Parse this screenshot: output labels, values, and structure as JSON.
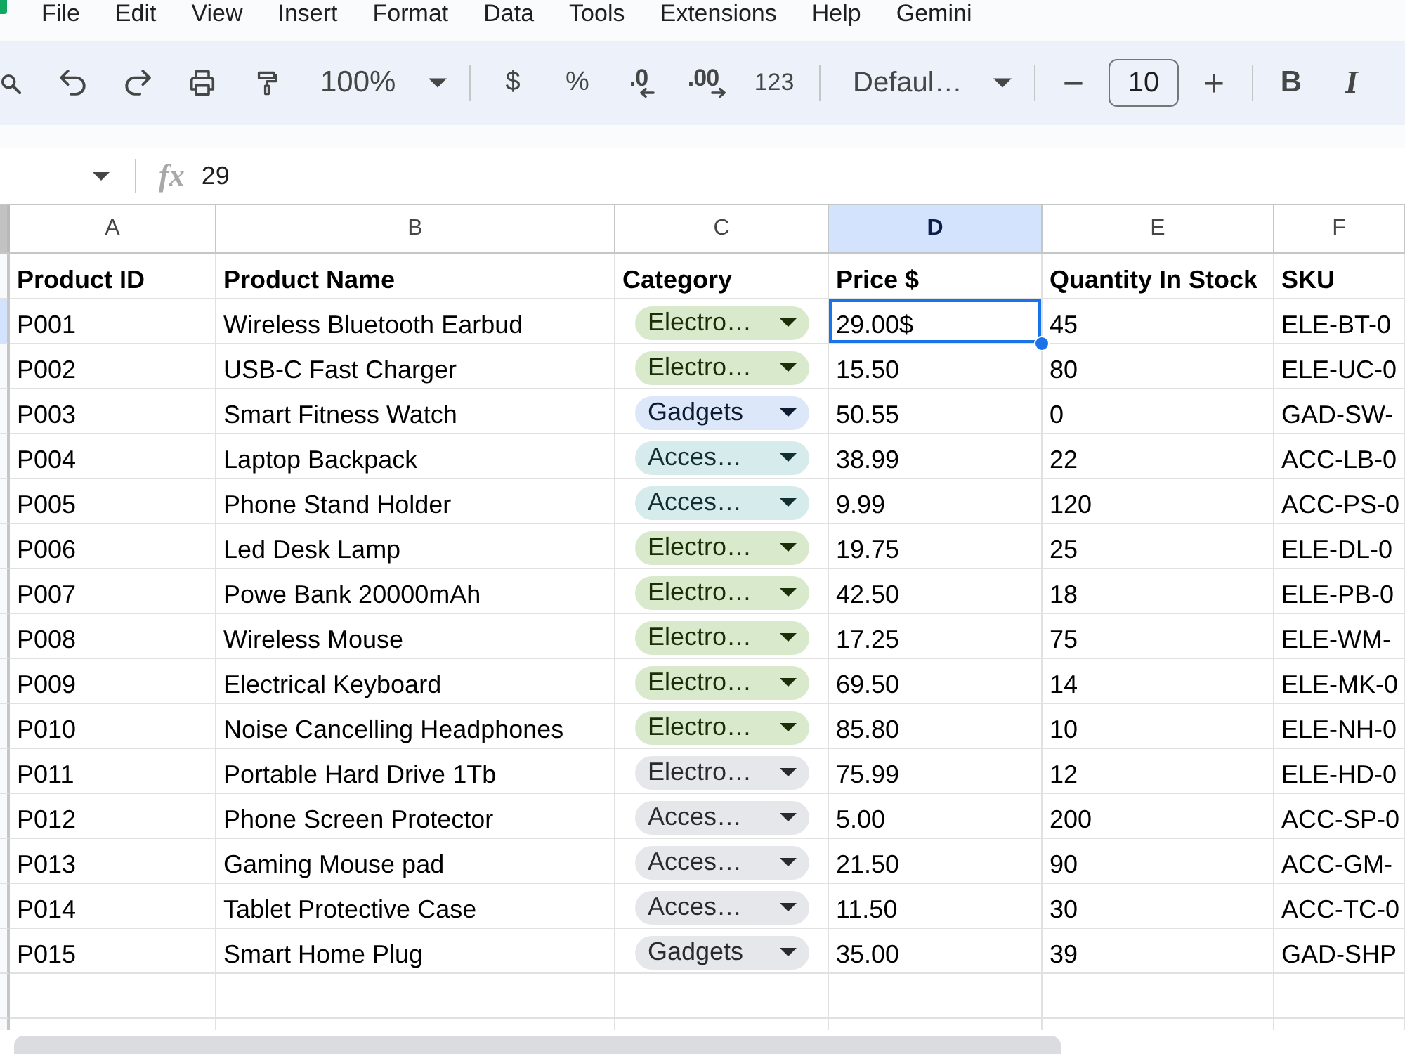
{
  "menu_bar": {
    "items": [
      "File",
      "Edit",
      "View",
      "Insert",
      "Format",
      "Data",
      "Tools",
      "Extensions",
      "Help",
      "Gemini"
    ]
  },
  "toolbar": {
    "items": [
      {
        "kind": "search"
      },
      {
        "kind": "undo"
      },
      {
        "kind": "redo"
      },
      {
        "kind": "print"
      },
      {
        "kind": "paint"
      },
      {
        "kind": "zoom",
        "label": "100%"
      },
      {
        "kind": "separator"
      },
      {
        "kind": "currency",
        "label": "$"
      },
      {
        "kind": "percent",
        "label": "%"
      },
      {
        "kind": "decimal_less",
        "label": ".0"
      },
      {
        "kind": "decimal_more",
        "label": ".00"
      },
      {
        "kind": "number_format",
        "label": "123"
      },
      {
        "kind": "separator"
      },
      {
        "kind": "font",
        "label": "Defaul…"
      },
      {
        "kind": "separator"
      },
      {
        "kind": "size_down",
        "label": "−"
      },
      {
        "kind": "size_field",
        "value": "10"
      },
      {
        "kind": "size_up",
        "label": "+"
      },
      {
        "kind": "separator"
      },
      {
        "kind": "bold",
        "label": "B"
      },
      {
        "kind": "italic",
        "label": "I"
      }
    ]
  },
  "formula_bar": {
    "function_label": "fx",
    "formula": "29"
  },
  "grid": {
    "columns": [
      {
        "label": "A",
        "selected": false
      },
      {
        "label": "B",
        "selected": false
      },
      {
        "label": "C",
        "selected": false
      },
      {
        "label": "D",
        "selected": true
      },
      {
        "label": "E",
        "selected": false
      },
      {
        "label": "F",
        "selected": false
      }
    ],
    "rows": [
      {
        "kind": "header",
        "selected": false,
        "cells": [
          {
            "kind": "text",
            "text": "Product ID"
          },
          {
            "kind": "text",
            "text": "Product Name"
          },
          {
            "kind": "text",
            "text": "Category"
          },
          {
            "kind": "text",
            "text": "Price $"
          },
          {
            "kind": "text",
            "text": "Quantity In Stock"
          },
          {
            "kind": "text",
            "text": "SKU"
          }
        ]
      },
      {
        "kind": "data",
        "selected": true,
        "cells": [
          {
            "kind": "text",
            "text": "P001"
          },
          {
            "kind": "text",
            "text": "Wireless Bluetooth Earbud"
          },
          {
            "kind": "chip",
            "text": "Electro…",
            "color": "#d9e9cb"
          },
          {
            "kind": "text",
            "text": "29.00$"
          },
          {
            "kind": "text",
            "text": "45"
          },
          {
            "kind": "text",
            "text": "ELE-BT-0"
          }
        ]
      },
      {
        "kind": "data",
        "selected": false,
        "cells": [
          {
            "kind": "text",
            "text": "P002"
          },
          {
            "kind": "text",
            "text": "USB-C Fast Charger"
          },
          {
            "kind": "chip",
            "text": "Electro…",
            "color": "#d9e9cb"
          },
          {
            "kind": "text",
            "text": "15.50"
          },
          {
            "kind": "text",
            "text": "80"
          },
          {
            "kind": "text",
            "text": "ELE-UC-0"
          }
        ]
      },
      {
        "kind": "data",
        "selected": false,
        "cells": [
          {
            "kind": "text",
            "text": "P003"
          },
          {
            "kind": "text",
            "text": "Smart Fitness Watch"
          },
          {
            "kind": "chip",
            "text": "Gadgets",
            "color": "#dce7f9"
          },
          {
            "kind": "text",
            "text": "50.55"
          },
          {
            "kind": "text",
            "text": "0"
          },
          {
            "kind": "text",
            "text": "GAD-SW-"
          }
        ]
      },
      {
        "kind": "data",
        "selected": false,
        "cells": [
          {
            "kind": "text",
            "text": "P004"
          },
          {
            "kind": "text",
            "text": "Laptop Backpack"
          },
          {
            "kind": "chip",
            "text": "Acces…",
            "color": "#d6ebec"
          },
          {
            "kind": "text",
            "text": "38.99"
          },
          {
            "kind": "text",
            "text": "22"
          },
          {
            "kind": "text",
            "text": "ACC-LB-0"
          }
        ]
      },
      {
        "kind": "data",
        "selected": false,
        "cells": [
          {
            "kind": "text",
            "text": "P005"
          },
          {
            "kind": "text",
            "text": "Phone Stand Holder"
          },
          {
            "kind": "chip",
            "text": "Acces…",
            "color": "#d6ebec"
          },
          {
            "kind": "text",
            "text": "9.99"
          },
          {
            "kind": "text",
            "text": "120"
          },
          {
            "kind": "text",
            "text": "ACC-PS-0"
          }
        ]
      },
      {
        "kind": "data",
        "selected": false,
        "cells": [
          {
            "kind": "text",
            "text": "P006"
          },
          {
            "kind": "text",
            "text": "Led Desk Lamp"
          },
          {
            "kind": "chip",
            "text": "Electro…",
            "color": "#d9e9cb"
          },
          {
            "kind": "text",
            "text": "19.75"
          },
          {
            "kind": "text",
            "text": "25"
          },
          {
            "kind": "text",
            "text": "ELE-DL-0"
          }
        ]
      },
      {
        "kind": "data",
        "selected": false,
        "cells": [
          {
            "kind": "text",
            "text": "P007"
          },
          {
            "kind": "text",
            "text": "Powe Bank 20000mAh"
          },
          {
            "kind": "chip",
            "text": "Electro…",
            "color": "#d9e9cb"
          },
          {
            "kind": "text",
            "text": "42.50"
          },
          {
            "kind": "text",
            "text": "18"
          },
          {
            "kind": "text",
            "text": "ELE-PB-0"
          }
        ]
      },
      {
        "kind": "data",
        "selected": false,
        "cells": [
          {
            "kind": "text",
            "text": "P008"
          },
          {
            "kind": "text",
            "text": "Wireless Mouse"
          },
          {
            "kind": "chip",
            "text": "Electro…",
            "color": "#d9e9cb"
          },
          {
            "kind": "text",
            "text": "17.25"
          },
          {
            "kind": "text",
            "text": "75"
          },
          {
            "kind": "text",
            "text": "ELE-WM-"
          }
        ]
      },
      {
        "kind": "data",
        "selected": false,
        "cells": [
          {
            "kind": "text",
            "text": "P009"
          },
          {
            "kind": "text",
            "text": "Electrical Keyboard"
          },
          {
            "kind": "chip",
            "text": "Electro…",
            "color": "#d9e9cb"
          },
          {
            "kind": "text",
            "text": "69.50"
          },
          {
            "kind": "text",
            "text": "14"
          },
          {
            "kind": "text",
            "text": "ELE-MK-0"
          }
        ]
      },
      {
        "kind": "data",
        "selected": false,
        "cells": [
          {
            "kind": "text",
            "text": "P010"
          },
          {
            "kind": "text",
            "text": "Noise Cancelling Headphones"
          },
          {
            "kind": "chip",
            "text": "Electro…",
            "color": "#d9e9cb"
          },
          {
            "kind": "text",
            "text": "85.80"
          },
          {
            "kind": "text",
            "text": "10"
          },
          {
            "kind": "text",
            "text": "ELE-NH-0"
          }
        ]
      },
      {
        "kind": "data",
        "selected": false,
        "cells": [
          {
            "kind": "text",
            "text": "P011"
          },
          {
            "kind": "text",
            "text": "Portable Hard Drive 1Tb"
          },
          {
            "kind": "chip",
            "text": "Electro…",
            "color": "#e6e7eb"
          },
          {
            "kind": "text",
            "text": "75.99"
          },
          {
            "kind": "text",
            "text": "12"
          },
          {
            "kind": "text",
            "text": "ELE-HD-0"
          }
        ]
      },
      {
        "kind": "data",
        "selected": false,
        "cells": [
          {
            "kind": "text",
            "text": "P012"
          },
          {
            "kind": "text",
            "text": "Phone Screen Protector"
          },
          {
            "kind": "chip",
            "text": "Acces…",
            "color": "#e6e7eb"
          },
          {
            "kind": "text",
            "text": "5.00"
          },
          {
            "kind": "text",
            "text": "200"
          },
          {
            "kind": "text",
            "text": "ACC-SP-0"
          }
        ]
      },
      {
        "kind": "data",
        "selected": false,
        "cells": [
          {
            "kind": "text",
            "text": "P013"
          },
          {
            "kind": "text",
            "text": "Gaming Mouse pad"
          },
          {
            "kind": "chip",
            "text": "Acces…",
            "color": "#e6e7eb"
          },
          {
            "kind": "text",
            "text": "21.50"
          },
          {
            "kind": "text",
            "text": "90"
          },
          {
            "kind": "text",
            "text": "ACC-GM-"
          }
        ]
      },
      {
        "kind": "data",
        "selected": false,
        "cells": [
          {
            "kind": "text",
            "text": "P014"
          },
          {
            "kind": "text",
            "text": "Tablet Protective Case"
          },
          {
            "kind": "chip",
            "text": "Acces…",
            "color": "#e6e7eb"
          },
          {
            "kind": "text",
            "text": "11.50"
          },
          {
            "kind": "text",
            "text": "30"
          },
          {
            "kind": "text",
            "text": "ACC-TC-0"
          }
        ]
      },
      {
        "kind": "data",
        "selected": false,
        "cells": [
          {
            "kind": "text",
            "text": "P015"
          },
          {
            "kind": "text",
            "text": "Smart Home Plug"
          },
          {
            "kind": "chip",
            "text": "Gadgets",
            "color": "#e6e7eb"
          },
          {
            "kind": "text",
            "text": "35.00"
          },
          {
            "kind": "text",
            "text": "39"
          },
          {
            "kind": "text",
            "text": "GAD-SHP"
          }
        ]
      }
    ]
  }
}
